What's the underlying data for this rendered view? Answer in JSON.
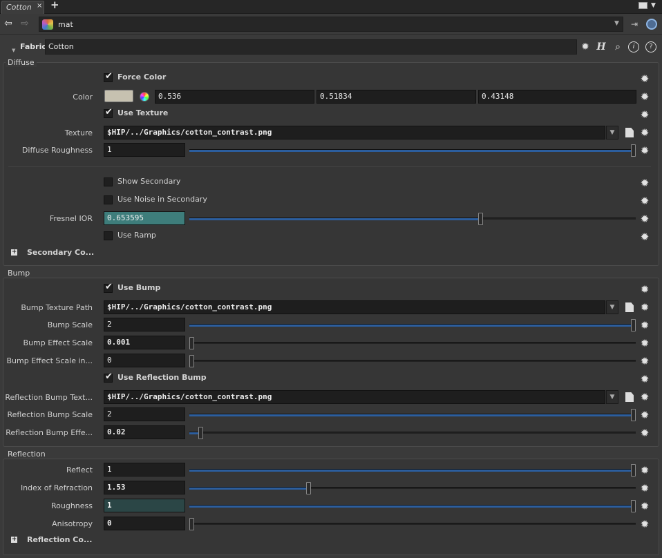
{
  "tab": {
    "label": "Cotton",
    "close": "×",
    "add": "+"
  },
  "nav": {
    "path": "mat",
    "drop": "▼"
  },
  "node": {
    "type": "Fabric",
    "name": "Cotton"
  },
  "icons": {
    "gear": "gear-icon",
    "help": "?",
    "info": "i",
    "h": "H"
  },
  "diffuse": {
    "title": "Diffuse",
    "force_color": {
      "label": "Force Color",
      "checked": true
    },
    "color": {
      "label": "Color",
      "r": "0.536",
      "g": "0.51834",
      "b": "0.43148",
      "swatch": "#c6c1b0"
    },
    "use_texture": {
      "label": "Use Texture",
      "checked": true
    },
    "texture": {
      "label": "Texture",
      "value": "$HIP/../Graphics/cotton_contrast.png"
    },
    "roughness": {
      "label": "Diffuse Roughness",
      "value": "1",
      "fraction": 1.0
    },
    "show_secondary": {
      "label": "Show Secondary",
      "checked": false
    },
    "noise_secondary": {
      "label": "Use Noise in Secondary",
      "checked": false
    },
    "fresnel": {
      "label": "Fresnel IOR",
      "value": "0.653595",
      "fraction": 0.653595
    },
    "use_ramp": {
      "label": "Use Ramp",
      "checked": false
    },
    "secondary_folder": "Secondary Co..."
  },
  "bump": {
    "title": "Bump",
    "use_bump": {
      "label": "Use Bump",
      "checked": true
    },
    "texture_path": {
      "label": "Bump Texture Path",
      "value": "$HIP/../Graphics/cotton_contrast.png"
    },
    "scale": {
      "label": "Bump Scale",
      "value": "2",
      "fraction": 1.0
    },
    "effect_scale": {
      "label": "Bump Effect Scale",
      "value": "0.001",
      "fraction": 0.0
    },
    "effect_scale_in": {
      "label": "Bump Effect Scale in...",
      "value": "0",
      "fraction": 0.0
    },
    "use_refl_bump": {
      "label": "Use Reflection Bump",
      "checked": true
    },
    "refl_texture": {
      "label": "Reflection Bump Text...",
      "value": "$HIP/../Graphics/cotton_contrast.png"
    },
    "refl_scale": {
      "label": "Reflection Bump Scale",
      "value": "2",
      "fraction": 1.0
    },
    "refl_effect": {
      "label": "Reflection Bump Effe...",
      "value": "0.02",
      "fraction": 0.02
    }
  },
  "reflection": {
    "title": "Reflection",
    "reflect": {
      "label": "Reflect",
      "value": "1",
      "fraction": 1.0
    },
    "ior": {
      "label": "Index of Refraction",
      "value": "1.53",
      "fraction": 0.265
    },
    "roughness": {
      "label": "Roughness",
      "value": "1",
      "fraction": 1.0
    },
    "anisotropy": {
      "label": "Anisotropy",
      "value": "0",
      "fraction": 0.0
    },
    "reflection_folder": "Reflection Co..."
  }
}
